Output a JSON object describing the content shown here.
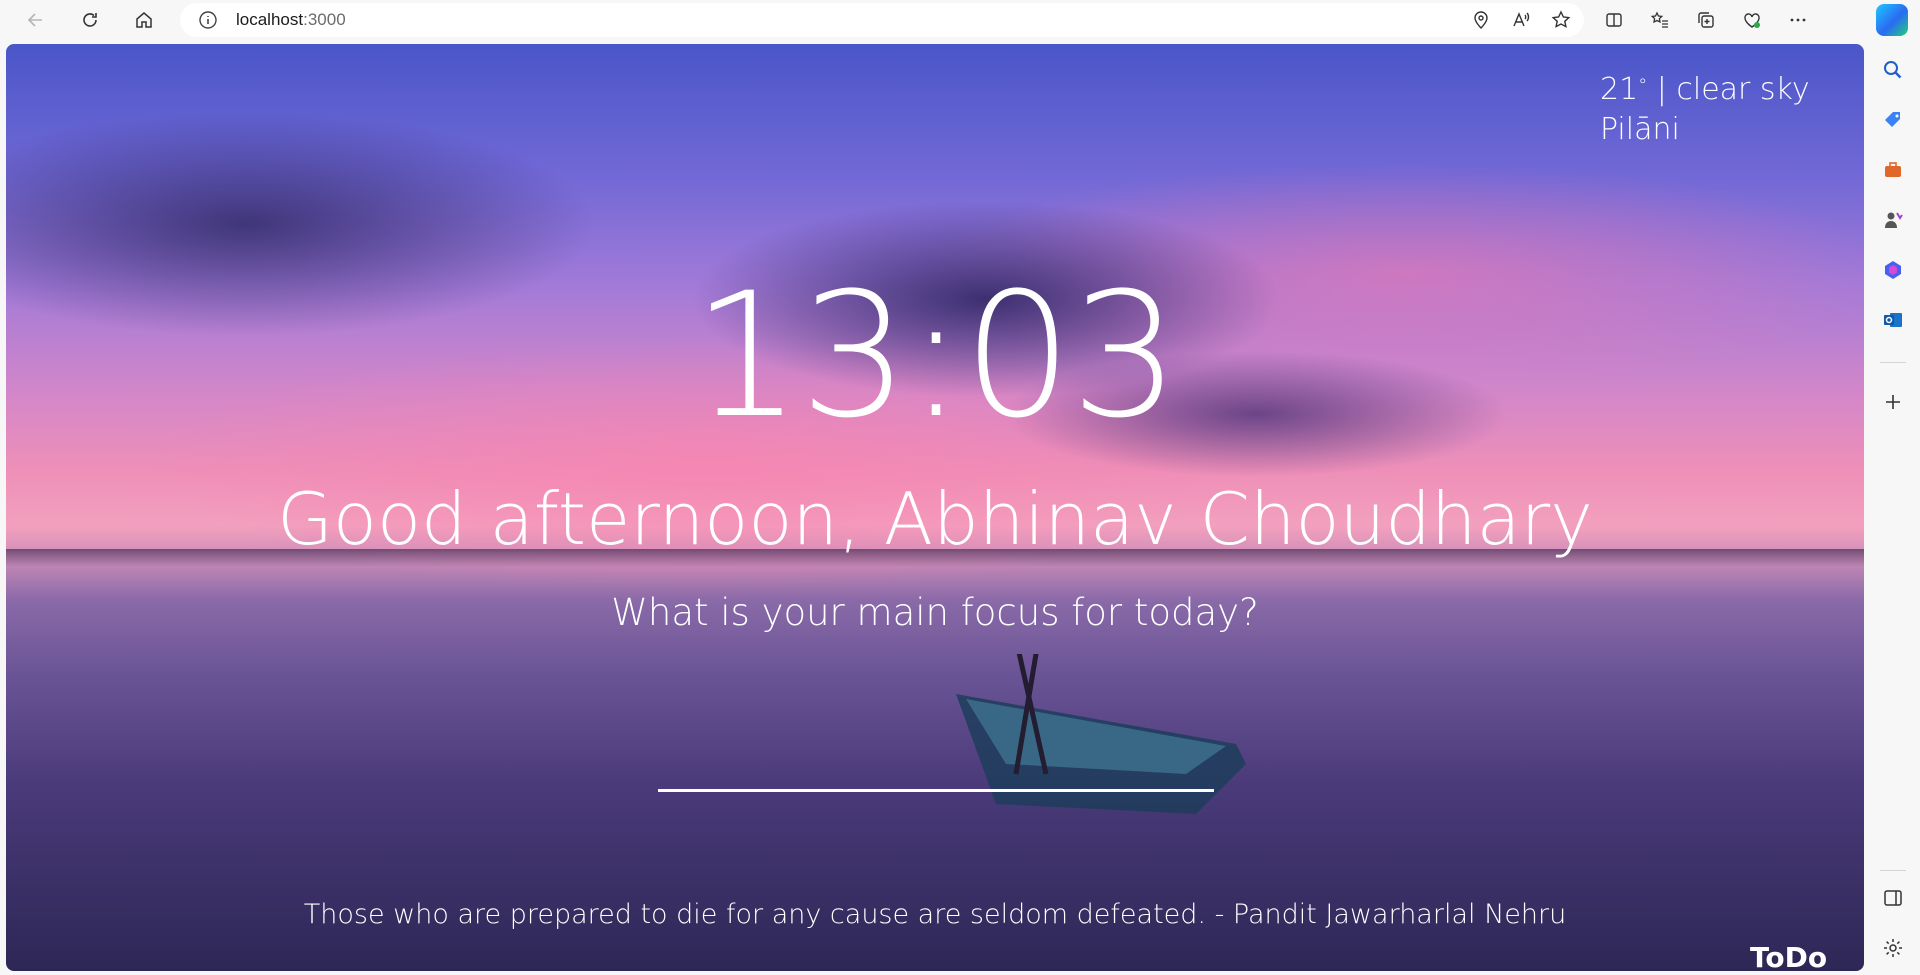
{
  "browser": {
    "url_host": "localhost",
    "url_port": ":3000"
  },
  "weather": {
    "temperature": "21",
    "degree_symbol": "°",
    "condition": "| clear sky",
    "location": "Pilāni"
  },
  "clock": {
    "time": "13:03"
  },
  "greeting": {
    "text": "Good afternoon, Abhinav Choudhary"
  },
  "focus": {
    "question": "What is your main focus for today?",
    "value": ""
  },
  "quote": {
    "text": "Those who are prepared to die for any cause are seldom defeated. - Pandit Jawarharlal Nehru"
  },
  "todo": {
    "label": "ToDo"
  }
}
